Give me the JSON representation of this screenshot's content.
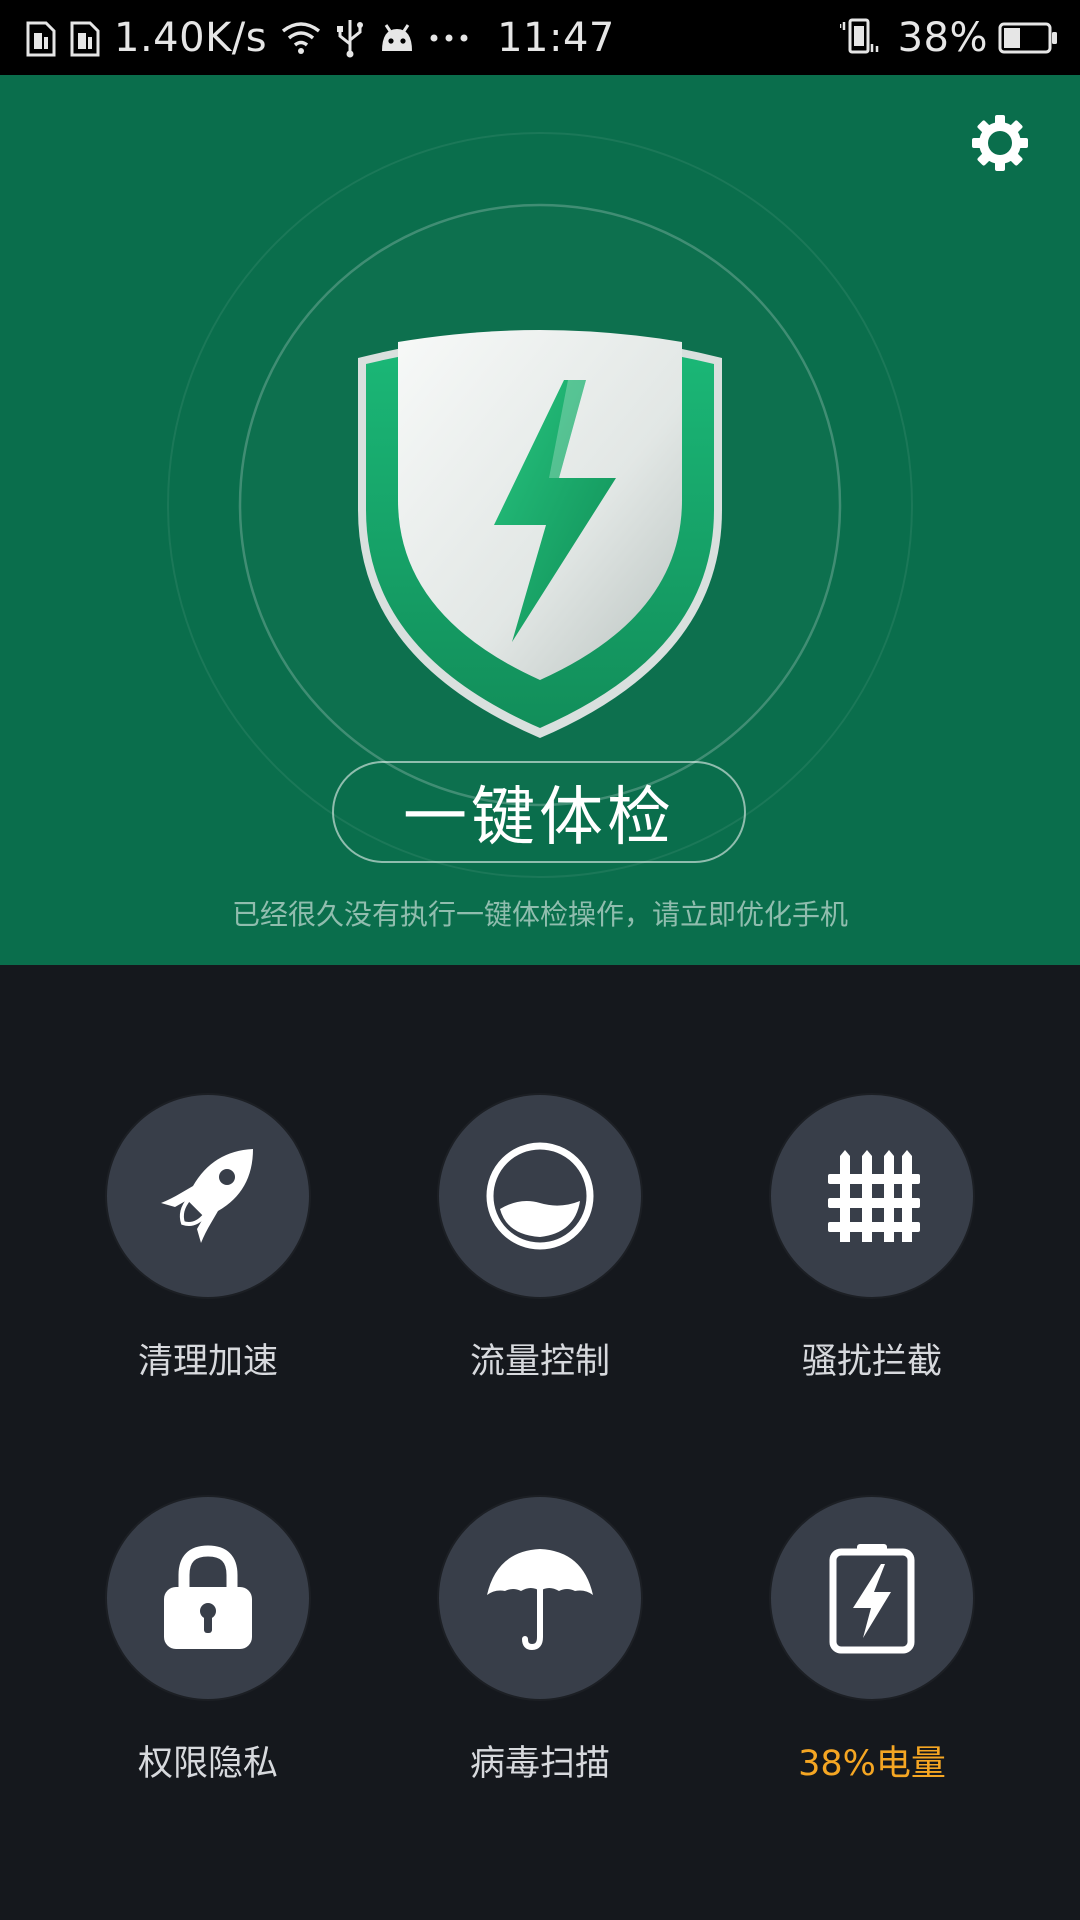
{
  "status_bar": {
    "network_speed": "1.40K/s",
    "time": "11:47",
    "battery_percent": "38%",
    "battery_level": 0.38,
    "icons": [
      "sim1-icon",
      "sim2-icon",
      "wifi-icon",
      "usb-icon",
      "android-icon",
      "more-dots-icon",
      "vibrate-icon",
      "battery-icon"
    ]
  },
  "hero": {
    "settings_icon": "gear-icon",
    "emblem": "shield-lightning-icon",
    "check_button_label": "一键体检",
    "hint_text": "已经很久没有执行一键体检操作，请立即优化手机"
  },
  "features": [
    {
      "label": "清理加速",
      "icon": "rocket-icon"
    },
    {
      "label": "流量控制",
      "icon": "data-gauge-icon"
    },
    {
      "label": "骚扰拦截",
      "icon": "fence-icon"
    },
    {
      "label": "权限隐私",
      "icon": "lock-icon"
    },
    {
      "label": "病毒扫描",
      "icon": "umbrella-icon"
    },
    {
      "label": "38%电量",
      "icon": "battery-charge-icon"
    }
  ],
  "colors": {
    "hero_bg": "#0a6e4c",
    "page_bg": "#15181d",
    "tile_bg": "#383e49",
    "accent": "#f5a623",
    "shield_green": "#16a56a"
  }
}
